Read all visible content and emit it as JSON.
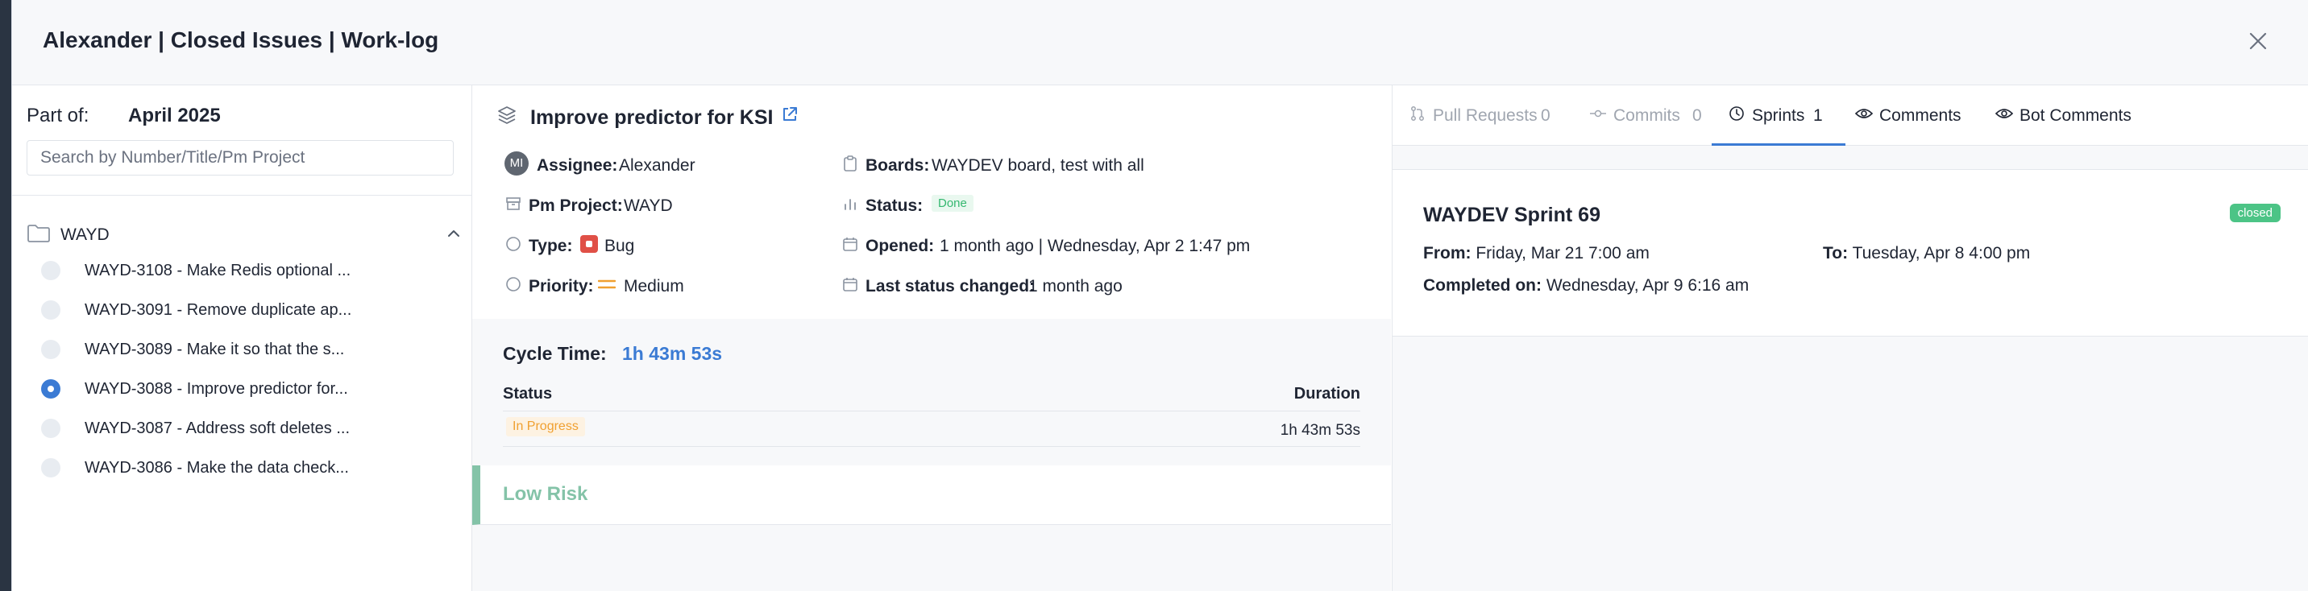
{
  "modal": {
    "title": "Alexander | Closed Issues | Work-log"
  },
  "left": {
    "part_of_label": "Part of:",
    "part_of_value": "April 2025",
    "search_placeholder": "Search by Number/Title/Pm Project",
    "group_label": "WAYD",
    "issues": [
      {
        "text": "WAYD-3108 - Make Redis optional ...",
        "selected": false
      },
      {
        "text": "WAYD-3091 - Remove duplicate ap...",
        "selected": false
      },
      {
        "text": "WAYD-3089 - Make it so that the s...",
        "selected": false
      },
      {
        "text": "WAYD-3088 - Improve predictor for...",
        "selected": true
      },
      {
        "text": "WAYD-3087 - Address soft deletes ...",
        "selected": false
      },
      {
        "text": "WAYD-3086 - Make the data check...",
        "selected": false
      }
    ]
  },
  "issue": {
    "title": "Improve predictor for KSI",
    "avatar_initials": "MI",
    "assignee_label": "Assignee:",
    "assignee_value": "Alexander",
    "boards_label": "Boards:",
    "boards_value": "WAYDEV board, test with all",
    "pm_project_label": "Pm Project:",
    "pm_project_value": "WAYD",
    "status_label": "Status:",
    "status_value": "Done",
    "type_label": "Type:",
    "type_value": "Bug",
    "opened_label": "Opened:",
    "opened_value": "1 month ago | Wednesday, Apr 2 1:47 pm",
    "priority_label": "Priority:",
    "priority_value": "Medium",
    "last_status_label": "Last status changed:",
    "last_status_value": "1 month ago"
  },
  "cycle": {
    "label": "Cycle Time:",
    "value": "1h 43m 53s",
    "col_status": "Status",
    "col_duration": "Duration",
    "row_status": "In Progress",
    "row_duration": "1h 43m 53s"
  },
  "risk": {
    "label": "Low Risk"
  },
  "tabs": [
    {
      "label": "Pull Requests",
      "count": "0",
      "icon": "pull-request-icon",
      "state": "disabled"
    },
    {
      "label": "Commits",
      "count": "0",
      "icon": "commit-icon",
      "state": "disabled"
    },
    {
      "label": "Sprints",
      "count": "1",
      "icon": "clock-icon",
      "state": "active"
    },
    {
      "label": "Comments",
      "count": "",
      "icon": "eye-icon",
      "state": "normal"
    },
    {
      "label": "Bot Comments",
      "count": "",
      "icon": "eye-icon",
      "state": "normal"
    }
  ],
  "sprint": {
    "name": "WAYDEV Sprint 69",
    "badge": "closed",
    "from_label": "From:",
    "from_value": "Friday, Mar 21 7:00 am",
    "to_label": "To:",
    "to_value": "Tuesday, Apr 8 4:00 pm",
    "completed_label": "Completed on:",
    "completed_value": "Wednesday, Apr 9 6:16 am"
  },
  "colors": {
    "accent": "#3b7bd4",
    "done": "#35b870",
    "in_progress": "#f0a030",
    "low_risk": "#84c3a8",
    "closed_badge": "#4cc486",
    "bug": "#e05047"
  }
}
